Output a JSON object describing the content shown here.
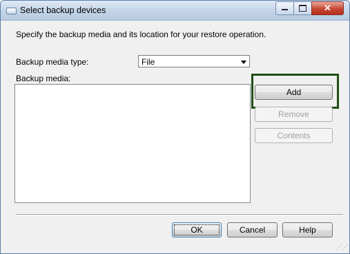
{
  "window": {
    "title": "Select backup devices",
    "minimize_icon": "minimize-icon",
    "maximize_icon": "maximize-icon",
    "close_icon": "close-icon",
    "close_glyph": "✕"
  },
  "instruction": "Specify the backup media and its location for your restore operation.",
  "media_type": {
    "label": "Backup media type:",
    "selected": "File"
  },
  "media_list": {
    "label": "Backup media:",
    "items": []
  },
  "side_buttons": {
    "add": "Add",
    "remove": "Remove",
    "contents": "Contents"
  },
  "footer_buttons": {
    "ok": "OK",
    "cancel": "Cancel",
    "help": "Help"
  },
  "colors": {
    "highlight_border": "#1f4e14",
    "close_button": "#c74634"
  }
}
